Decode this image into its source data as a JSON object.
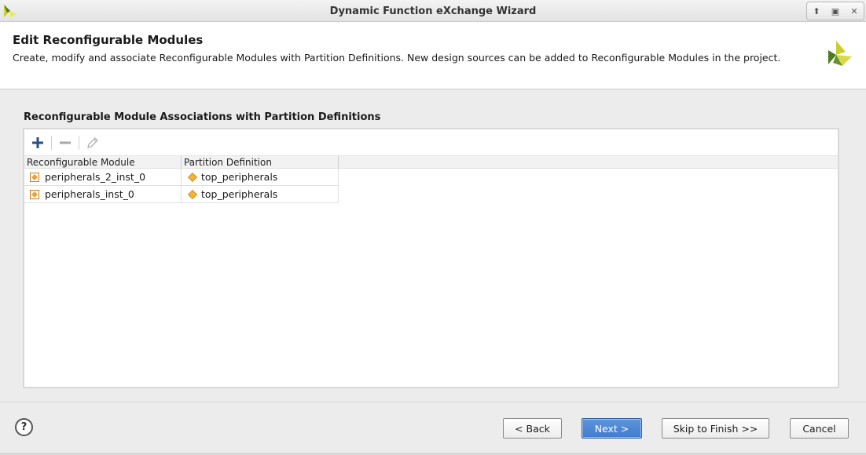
{
  "window": {
    "title": "Dynamic Function eXchange Wizard",
    "controls": [
      "minimize",
      "maximize",
      "close"
    ]
  },
  "header": {
    "title": "Edit Reconfigurable Modules",
    "description": "Create, modify and associate Reconfigurable Modules with Partition Definitions. New design sources can be added to Reconfigurable Modules in the project."
  },
  "section": {
    "title": "Reconfigurable Module Associations with Partition Definitions"
  },
  "toolbar": {
    "add_icon": "plus-icon",
    "remove_icon": "minus-icon",
    "edit_icon": "pencil-icon"
  },
  "table": {
    "columns": [
      "Reconfigurable Module",
      "Partition Definition"
    ],
    "rows": [
      {
        "module": "peripherals_2_inst_0",
        "partition": "top_peripherals"
      },
      {
        "module": "peripherals_inst_0",
        "partition": "top_peripherals"
      }
    ]
  },
  "footer": {
    "help_label": "?",
    "back_label": "< Back",
    "next_label": "Next >",
    "skip_label": "Skip to Finish >>",
    "cancel_label": "Cancel"
  },
  "colors": {
    "logo_yellow": "#c9cf2a",
    "logo_green": "#4f7a1f",
    "accent_blue": "#3f7bcf",
    "module_icon": "#e8a23a",
    "partition_icon": "#f0b23c"
  }
}
